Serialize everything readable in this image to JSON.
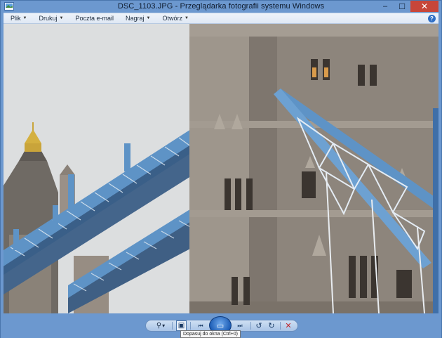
{
  "window": {
    "title": "DSC_1103.JPG - Przeglądarka fotografii systemu Windows",
    "controls": {
      "minimize": "–",
      "maximize": "☐",
      "close": "✕"
    }
  },
  "menu": {
    "items": [
      {
        "label": "Plik"
      },
      {
        "label": "Drukuj"
      },
      {
        "label": "Poczta e-mail"
      },
      {
        "label": "Nagraj"
      },
      {
        "label": "Otwórz"
      }
    ],
    "dropdown_arrow": "▼",
    "help": "?"
  },
  "photo": {
    "subject": "Tower Bridge, London",
    "colors": {
      "sky": "#dcdedf",
      "stone": "#8b8279",
      "walkway": "#5c90c2"
    }
  },
  "toolbar": {
    "zoom_glyph": "⚲",
    "zoom_arrow": "▾",
    "fit_glyph": "▣",
    "prev_glyph": "⏮",
    "slideshow_glyph": "▭",
    "next_glyph": "⏭",
    "rotate_ccw_glyph": "↺",
    "rotate_cw_glyph": "↻",
    "delete_glyph": "✕"
  },
  "tooltip": {
    "text": "Dopasuj do okna (Ctrl+0)"
  }
}
